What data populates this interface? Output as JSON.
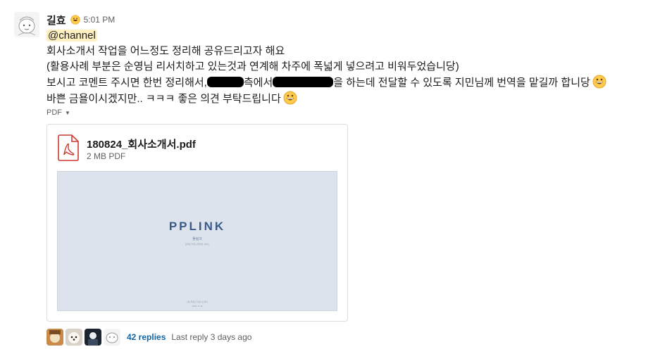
{
  "message": {
    "sender": "길효",
    "time": "5:01 PM",
    "mention": "@channel",
    "lines": [
      "회사소개서 작업을 어느정도 정리해 공유드리고자 해요",
      "(활용사례 부분은 순영님 리서치하고 있는것과 연계해 차주에 폭넓게 넣으려고 비워두었습니당)"
    ],
    "line3_a": "보시고 코멘트 주시면 한번 정리해서,",
    "line3_b": "측에서",
    "line3_c": "을 하는데 전달할 수 있도록 지민님께 번역을 맡길까 합니당",
    "line4": "바쁜 금욜이시겠지만.. ㅋㅋㅋ 좋은 의견 부탁드립니다"
  },
  "attachment": {
    "toggle_label": "PDF",
    "file_name": "180824_회사소개서.pdf",
    "file_size": "2 MB PDF",
    "preview": {
      "title": "PPLINK",
      "subtitle": "플링크",
      "tagline": "모바일 커뮤니케이션 서비스",
      "footer1": "(주) 플링크 회사 소개서",
      "footer2": "2018. 8. 24"
    }
  },
  "thread": {
    "replies_label": "42 replies",
    "last_reply": "Last reply 3 days ago"
  },
  "colors": {
    "mention_bg": "#fff0c1",
    "link": "#1264a3",
    "pdf_red": "#d13a32",
    "preview_bg": "#dde3ec",
    "preview_title": "#3a5a8a"
  },
  "icons": [
    "grinning-emoji-icon",
    "chevron-down-icon",
    "pdf-file-icon"
  ]
}
